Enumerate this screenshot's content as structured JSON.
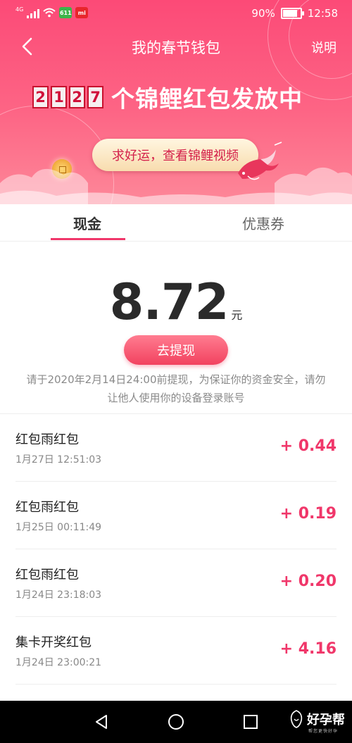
{
  "status_bar": {
    "network": "4G",
    "app_badge_1": "611",
    "app_badge_2": "mi",
    "battery_percent": 90,
    "battery_label": "90%",
    "time": "12:58"
  },
  "nav": {
    "back_icon": "chevron-left-icon",
    "title": "我的春节钱包",
    "help_label": "说明"
  },
  "banner": {
    "digits": [
      "2",
      "1",
      "2",
      "7"
    ],
    "text": "个锦鲤红包发放中",
    "koi_button_label": "求好运，查看锦鲤视频"
  },
  "tabs": {
    "cash_label": "现金",
    "coupon_label": "优惠券",
    "active": "cash"
  },
  "balance": {
    "amount": "8.72",
    "unit": "元",
    "withdraw_label": "去提现",
    "notice": "请于2020年2月14日24:00前提现，为保证你的资金安全，请勿让他人使用你的设备登录账号"
  },
  "records": [
    {
      "title": "红包雨红包",
      "time": "1月27日 12:51:03",
      "amount": "+ 0.44"
    },
    {
      "title": "红包雨红包",
      "time": "1月25日 00:11:49",
      "amount": "+ 0.19"
    },
    {
      "title": "红包雨红包",
      "time": "1月24日 23:18:03",
      "amount": "+ 0.20"
    },
    {
      "title": "集卡开奖红包",
      "time": "1月24日 23:00:21",
      "amount": "+ 4.16"
    }
  ],
  "watermark": {
    "text": "好孕帮",
    "sub": "帮您更快好孕"
  },
  "colors": {
    "accent": "#f0376a",
    "header_top": "#fc4a77",
    "header_bottom": "#fd8899"
  }
}
